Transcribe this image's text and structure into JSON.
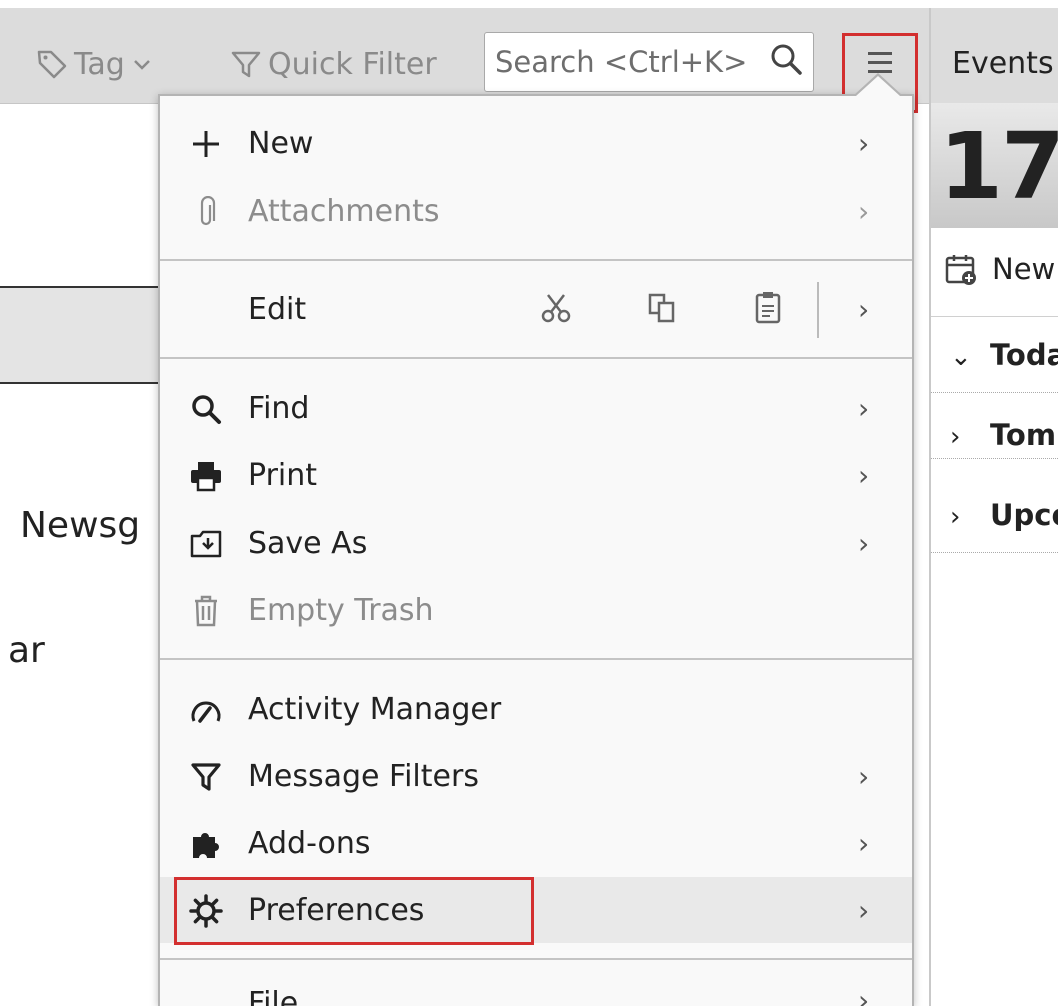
{
  "toolbar": {
    "tag_label": "Tag",
    "quick_filter_label": "Quick Filter",
    "search_placeholder": "Search <Ctrl+K>"
  },
  "left_pane": {
    "items": [
      "Newsg",
      "ar"
    ]
  },
  "events_pane": {
    "title": "Events",
    "date_number": "17",
    "new_event_label": "New",
    "agenda": [
      {
        "label": "Toda",
        "expanded": true
      },
      {
        "label": "Tom",
        "expanded": false
      },
      {
        "label": "Upco",
        "expanded": false
      }
    ]
  },
  "menu": {
    "new": {
      "label": "New",
      "icon": "plus-icon",
      "has_submenu": true
    },
    "attachments": {
      "label": "Attachments",
      "icon": "paperclip-icon",
      "disabled": true,
      "has_submenu": true
    },
    "edit": {
      "label": "Edit",
      "tools": [
        "cut-icon",
        "copy-icon",
        "paste-icon"
      ],
      "has_submenu": true
    },
    "find": {
      "label": "Find",
      "icon": "search-icon",
      "has_submenu": true
    },
    "print": {
      "label": "Print",
      "icon": "printer-icon",
      "has_submenu": true
    },
    "save_as": {
      "label": "Save As",
      "icon": "save-as-icon",
      "has_submenu": true
    },
    "empty_trash": {
      "label": "Empty Trash",
      "icon": "trash-icon",
      "disabled": true
    },
    "activity_manager": {
      "label": "Activity Manager",
      "icon": "gauge-icon"
    },
    "message_filters": {
      "label": "Message Filters",
      "icon": "filter-icon",
      "has_submenu": true
    },
    "addons": {
      "label": "Add-ons",
      "icon": "puzzle-icon",
      "has_submenu": true
    },
    "preferences": {
      "label": "Preferences",
      "icon": "gear-icon",
      "has_submenu": true,
      "hovered": true
    },
    "file": {
      "label": "File",
      "has_submenu": true
    }
  },
  "colors": {
    "highlight": "#d32f2f",
    "toolbar_bg": "#dcdcdc",
    "menu_bg": "#f9f9f9",
    "hover_bg": "#e9e9e9"
  }
}
